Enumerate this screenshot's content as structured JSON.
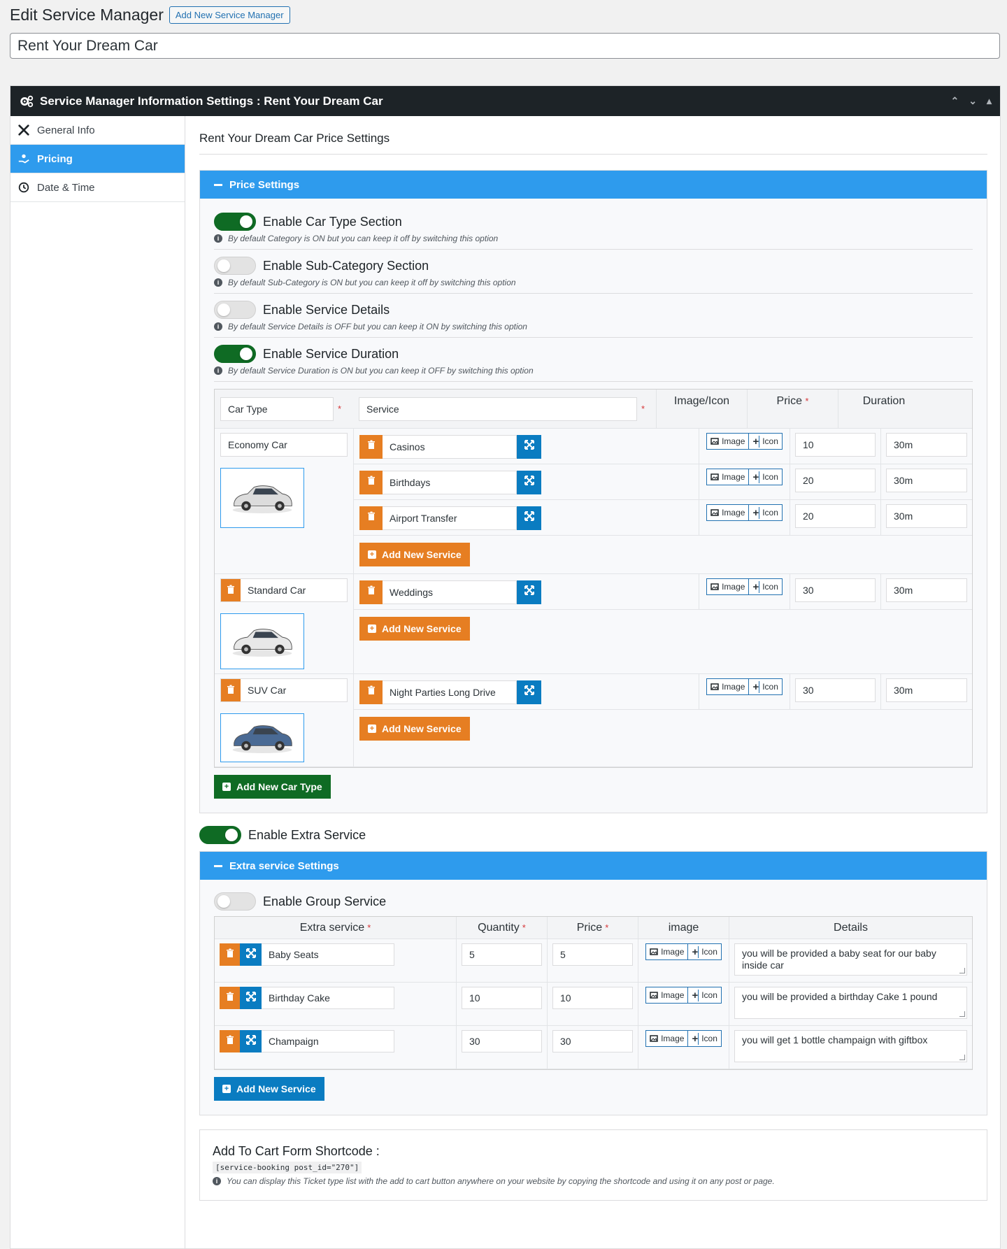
{
  "header": {
    "title": "Edit Service Manager",
    "add_new_label": "Add New Service Manager"
  },
  "post_title": "Rent Your Dream Car",
  "box": {
    "title": "Service Manager Information Settings : Rent Your Dream Car",
    "controls": [
      "chevron-up",
      "chevron-down",
      "triangle-up"
    ]
  },
  "sidebar": {
    "items": [
      {
        "label": "General Info",
        "icon": "tools-icon",
        "active": false
      },
      {
        "label": "Pricing",
        "icon": "hand-money-icon",
        "active": true
      },
      {
        "label": "Date & Time",
        "icon": "clock-icon",
        "active": false
      }
    ]
  },
  "pricing": {
    "section_title": "Rent Your Dream Car Price Settings",
    "price_settings_label": "Price Settings",
    "toggles": [
      {
        "label": "Enable Car Type Section",
        "hint": "By default Category is ON but you can keep it off by switching this option",
        "on": true
      },
      {
        "label": "Enable Sub-Category Section",
        "hint": "By default Sub-Category is ON but you can keep it off by switching this option",
        "on": false
      },
      {
        "label": "Enable Service Details",
        "hint": "By default Service Details is OFF but you can keep it ON by switching this option",
        "on": false
      },
      {
        "label": "Enable Service Duration",
        "hint": "By default Service Duration is ON but you can keep it OFF by switching this option",
        "on": true
      }
    ],
    "table_head": {
      "car_type": "Car Type",
      "service": "Service",
      "image_icon": "Image/Icon",
      "price": "Price",
      "duration": "Duration",
      "required": "*"
    },
    "image_label": "Image",
    "icon_label": "Icon",
    "add_service_label": "Add New Service",
    "add_car_type_label": "Add New Car Type",
    "car_types": [
      {
        "name": "Economy Car",
        "has_delete": false,
        "services": [
          {
            "name": "Casinos",
            "price": "10",
            "duration": "30m"
          },
          {
            "name": "Birthdays",
            "price": "20",
            "duration": "30m"
          },
          {
            "name": "Airport Transfer",
            "price": "20",
            "duration": "30m"
          }
        ]
      },
      {
        "name": "Standard Car",
        "has_delete": true,
        "services": [
          {
            "name": "Weddings",
            "price": "30",
            "duration": "30m"
          }
        ]
      },
      {
        "name": "SUV Car",
        "has_delete": true,
        "services": [
          {
            "name": "Night Parties Long Drive",
            "price": "30",
            "duration": "30m"
          }
        ]
      }
    ]
  },
  "extra": {
    "enable_label": "Enable Extra Service",
    "enabled": true,
    "settings_label": "Extra service Settings",
    "group_label": "Enable Group Service",
    "group_enabled": false,
    "head": {
      "service": "Extra service",
      "quantity": "Quantity",
      "price": "Price",
      "image": "image",
      "details": "Details"
    },
    "rows": [
      {
        "name": "Baby Seats",
        "quantity": "5",
        "price": "5",
        "details": "you will be provided a baby seat for our baby inside car"
      },
      {
        "name": "Birthday Cake",
        "quantity": "10",
        "price": "10",
        "details": "you will be provided a birthday Cake 1 pound"
      },
      {
        "name": "Champaign",
        "quantity": "30",
        "price": "30",
        "details": "you will get 1 bottle champaign with giftbox"
      }
    ],
    "add_label": "Add New Service"
  },
  "shortcode": {
    "title": "Add To Cart Form Shortcode :",
    "code": "[service-booking post_id=\"270\"]",
    "hint": "You can display this Ticket type list with the add to cart button anywhere on your website by copying the shortcode and using it on any post or page."
  },
  "colors": {
    "accent": "#2e9bed",
    "orange": "#e67e22",
    "blue": "#0a7cc1",
    "green": "#0f6b24",
    "dark": "#1d2327"
  }
}
